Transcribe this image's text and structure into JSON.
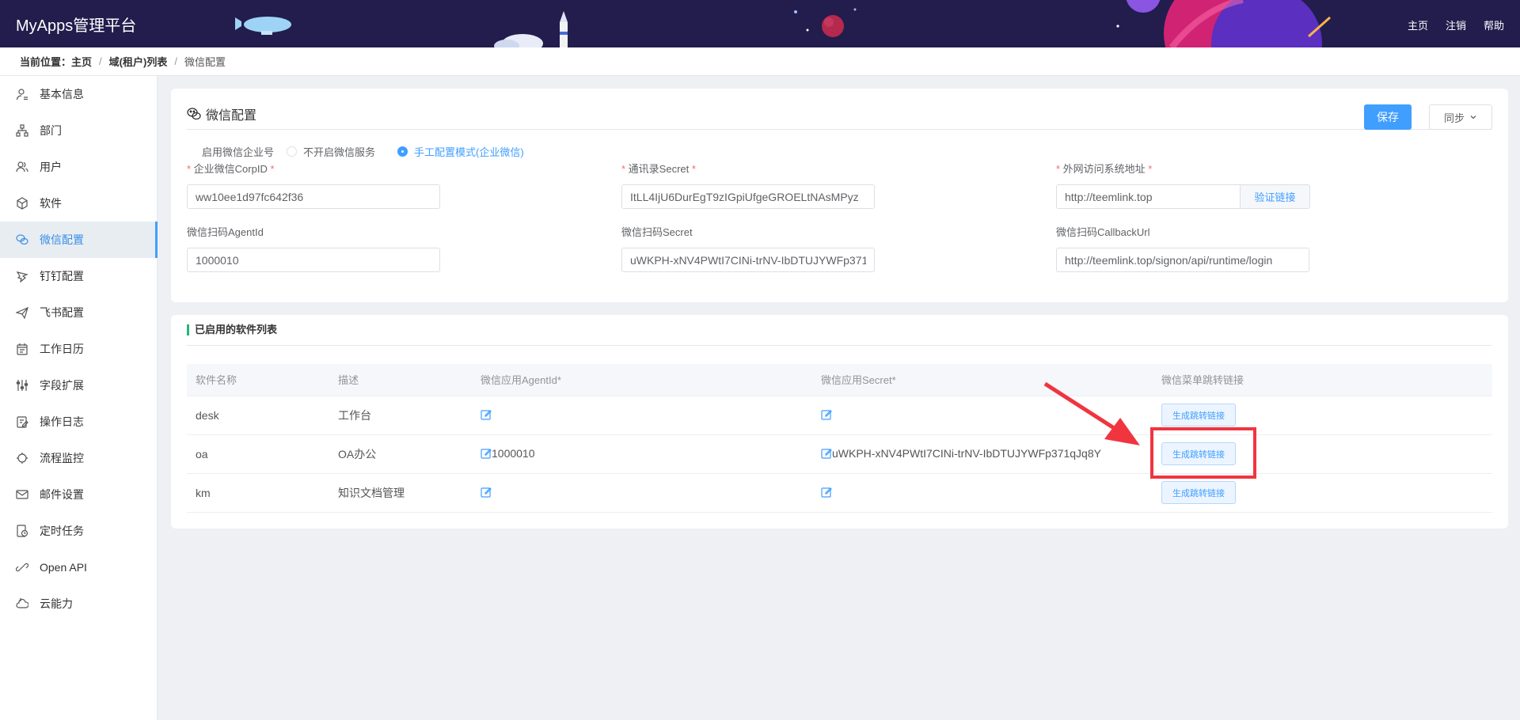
{
  "header": {
    "app_title": "MyApps管理平台",
    "nav": [
      "主页",
      "注销",
      "帮助"
    ]
  },
  "breadcrumb": {
    "prefix": "当前位置：",
    "items": [
      "主页",
      "域(租户)列表",
      "微信配置"
    ]
  },
  "sidebar": {
    "items": [
      {
        "label": "基本信息",
        "icon": "user-info-icon"
      },
      {
        "label": "部门",
        "icon": "org-tree-icon"
      },
      {
        "label": "用户",
        "icon": "users-icon"
      },
      {
        "label": "软件",
        "icon": "cube-icon"
      },
      {
        "label": "微信配置",
        "icon": "wechat-icon",
        "active": true
      },
      {
        "label": "钉钉配置",
        "icon": "dingtalk-icon"
      },
      {
        "label": "飞书配置",
        "icon": "feishu-icon"
      },
      {
        "label": "工作日历",
        "icon": "calendar-icon"
      },
      {
        "label": "字段扩展",
        "icon": "sliders-icon"
      },
      {
        "label": "操作日志",
        "icon": "log-icon"
      },
      {
        "label": "流程监控",
        "icon": "monitor-icon"
      },
      {
        "label": "邮件设置",
        "icon": "mail-icon"
      },
      {
        "label": "定时任务",
        "icon": "timer-icon"
      },
      {
        "label": "Open API",
        "icon": "api-icon"
      },
      {
        "label": "云能力",
        "icon": "cloud-icon"
      }
    ]
  },
  "config": {
    "title": "微信配置",
    "save_label": "保存",
    "sync_label": "同步",
    "enable_label": "启用微信企业号",
    "radio_off": "不开启微信服务",
    "radio_manual": "手工配置模式(企业微信)",
    "corp_id_label": "企业微信CorpID",
    "corp_id_value": "ww10ee1d97fc642f36",
    "contacts_secret_label": "通讯录Secret",
    "contacts_secret_value": "ItLL4IjU6DurEgT9zIGpiUfgeGROELtNAsMPyz",
    "external_url_label": "外网访问系统地址",
    "external_url_value": "http://teemlink.top",
    "verify_link_label": "验证链接",
    "agent_id_label": "微信扫码AgentId",
    "agent_id_value": "1000010",
    "scan_secret_label": "微信扫码Secret",
    "scan_secret_value": "uWKPH-xNV4PWtI7CINi-trNV-IbDTUJYWFp371",
    "callback_label": "微信扫码CallbackUrl",
    "callback_value": "http://teemlink.top/signon/api/runtime/login"
  },
  "software_list": {
    "title": "已启用的软件列表",
    "columns": [
      "软件名称",
      "描述",
      "微信应用AgentId*",
      "微信应用Secret*",
      "微信菜单跳转链接"
    ],
    "rows": [
      {
        "name": "desk",
        "desc": "工作台",
        "agent_id": "",
        "secret": "",
        "button": "生成跳转链接"
      },
      {
        "name": "oa",
        "desc": "OA办公",
        "agent_id": "1000010",
        "secret": "uWKPH-xNV4PWtI7CINi-trNV-IbDTUJYWFp371qJq8Y",
        "button": "生成跳转链接"
      },
      {
        "name": "km",
        "desc": "知识文档管理",
        "agent_id": "",
        "secret": "",
        "button": "生成跳转链接"
      }
    ]
  },
  "colors": {
    "header_bg": "#221d4d",
    "primary": "#409eff",
    "annotation": "#f0353f",
    "list_accent": "#27b37c"
  }
}
